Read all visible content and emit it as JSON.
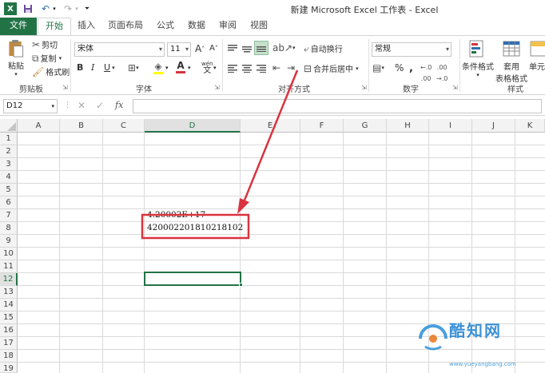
{
  "window": {
    "title": "新建 Microsoft Excel 工作表 - Excel"
  },
  "tabs": [
    "文件",
    "开始",
    "插入",
    "页面布局",
    "公式",
    "数据",
    "审阅",
    "视图"
  ],
  "ribbon": {
    "clipboard": {
      "paste": "粘贴",
      "cut": "剪切",
      "copy": "复制",
      "format_painter": "格式刷",
      "group_label": "剪贴板"
    },
    "font": {
      "font_name": "宋体",
      "font_size": "11",
      "bold": "B",
      "italic": "I",
      "underline": "U",
      "grow": "A",
      "shrink": "A",
      "phonetic": "wén",
      "group_label": "字体"
    },
    "alignment": {
      "wrap_text": "自动换行",
      "merge_center": "合并后居中",
      "group_label": "对齐方式"
    },
    "number": {
      "format": "常规",
      "percent": "%",
      "comma": ",",
      "group_label": "数字"
    },
    "styles": {
      "conditional_formatting": "条件格式",
      "format_as_table_line1": "套用",
      "format_as_table_line2": "表格格式",
      "cell_styles": "单元",
      "group_label": "样式"
    }
  },
  "formula_bar": {
    "name_box": "D12",
    "fx": "fx",
    "value": ""
  },
  "sheet": {
    "columns": [
      "A",
      "B",
      "C",
      "D",
      "E",
      "F",
      "G",
      "H",
      "I",
      "J",
      "K"
    ],
    "rows": [
      "1",
      "2",
      "3",
      "4",
      "5",
      "6",
      "7",
      "8",
      "9",
      "10",
      "11",
      "12",
      "13",
      "14",
      "15",
      "16",
      "17",
      "18",
      "19"
    ],
    "selected_cell": "D12",
    "cells": {
      "D7": "4.20002E+17",
      "D8": "420002201810218102"
    }
  },
  "watermark": {
    "brand": "酷知网",
    "site": "www.yueyangbang.com"
  },
  "colors": {
    "excel_green": "#217346",
    "annotation_red": "#d9333f",
    "grid_line": "#dadada"
  }
}
